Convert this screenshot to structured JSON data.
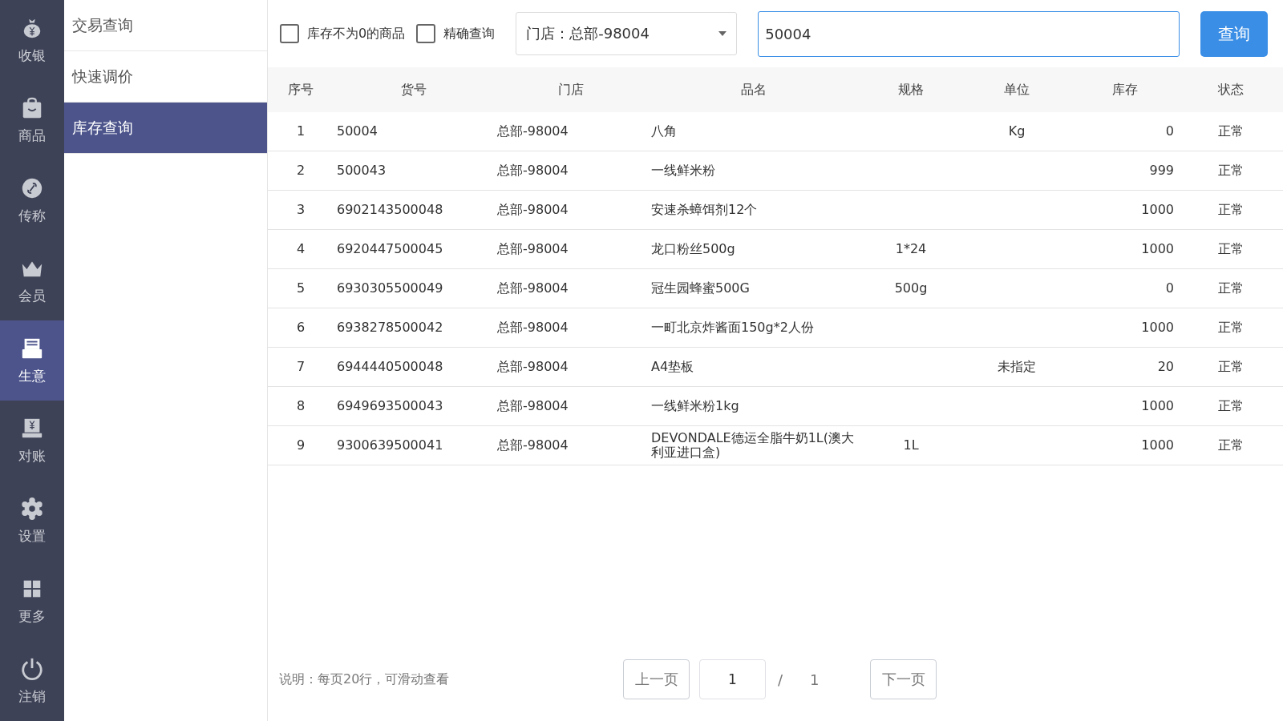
{
  "nav": [
    {
      "label": "收银",
      "selected": false
    },
    {
      "label": "商品",
      "selected": false
    },
    {
      "label": "传称",
      "selected": false
    },
    {
      "label": "会员",
      "selected": false
    },
    {
      "label": "生意",
      "selected": true
    },
    {
      "label": "对账",
      "selected": false
    },
    {
      "label": "设置",
      "selected": false
    },
    {
      "label": "更多",
      "selected": false
    },
    {
      "label": "注销",
      "selected": false
    }
  ],
  "submenu": [
    {
      "label": "交易查询",
      "selected": false
    },
    {
      "label": "快速调价",
      "selected": false
    },
    {
      "label": "库存查询",
      "selected": true
    }
  ],
  "filters": {
    "checkboxes": [
      {
        "label": "库存不为0的商品",
        "checked": false
      },
      {
        "label": "精确查询",
        "checked": false
      }
    ],
    "store_select": {
      "value": "门店：总部-98004"
    },
    "search": {
      "value": "50004"
    },
    "query_button": "查询"
  },
  "table": {
    "columns": [
      "序号",
      "货号",
      "门店",
      "品名",
      "规格",
      "单位",
      "库存",
      "状态"
    ],
    "rows": [
      [
        "1",
        "50004",
        "总部-98004",
        "八角",
        "",
        "Kg",
        "0",
        "正常"
      ],
      [
        "2",
        "500043",
        "总部-98004",
        "一线鲜米粉",
        "",
        "",
        "999",
        "正常"
      ],
      [
        "3",
        "6902143500048",
        "总部-98004",
        "安速杀蟑饵剂12个",
        "",
        "",
        "1000",
        "正常"
      ],
      [
        "4",
        "6920447500045",
        "总部-98004",
        "龙口粉丝500g",
        "1*24",
        "",
        "1000",
        "正常"
      ],
      [
        "5",
        "6930305500049",
        "总部-98004",
        "冠生园蜂蜜500G",
        "500g",
        "",
        "0",
        "正常"
      ],
      [
        "6",
        "6938278500042",
        "总部-98004",
        "一町北京炸酱面150g*2人份",
        "",
        "",
        "1000",
        "正常"
      ],
      [
        "7",
        "6944440500048",
        "总部-98004",
        "A4垫板",
        "",
        "未指定",
        "20",
        "正常"
      ],
      [
        "8",
        "6949693500043",
        "总部-98004",
        "一线鲜米粉1kg",
        "",
        "",
        "1000",
        "正常"
      ],
      [
        "9",
        "9300639500041",
        "总部-98004",
        "DEVONDALE德运全脂牛奶1L(澳大利亚进口盒)",
        "1L",
        "",
        "1000",
        "正常"
      ]
    ]
  },
  "footer": {
    "note": "说明：每页20行，可滑动查看",
    "prev_button": "上一页",
    "page_input": "1",
    "separator": "/",
    "total_pages": "1",
    "next_button": "下一页"
  }
}
